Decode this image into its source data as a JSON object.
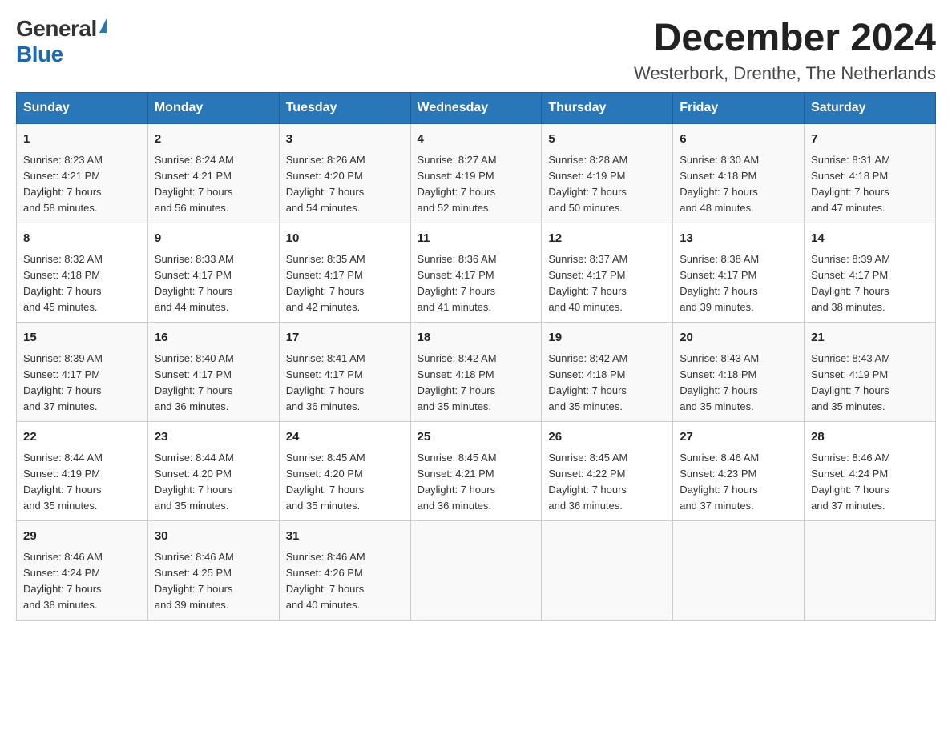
{
  "logo": {
    "general": "General",
    "blue": "Blue"
  },
  "title": "December 2024",
  "location": "Westerbork, Drenthe, The Netherlands",
  "days_of_week": [
    "Sunday",
    "Monday",
    "Tuesday",
    "Wednesday",
    "Thursday",
    "Friday",
    "Saturday"
  ],
  "weeks": [
    [
      {
        "day": "1",
        "sunrise": "8:23 AM",
        "sunset": "4:21 PM",
        "daylight": "7 hours and 58 minutes."
      },
      {
        "day": "2",
        "sunrise": "8:24 AM",
        "sunset": "4:21 PM",
        "daylight": "7 hours and 56 minutes."
      },
      {
        "day": "3",
        "sunrise": "8:26 AM",
        "sunset": "4:20 PM",
        "daylight": "7 hours and 54 minutes."
      },
      {
        "day": "4",
        "sunrise": "8:27 AM",
        "sunset": "4:19 PM",
        "daylight": "7 hours and 52 minutes."
      },
      {
        "day": "5",
        "sunrise": "8:28 AM",
        "sunset": "4:19 PM",
        "daylight": "7 hours and 50 minutes."
      },
      {
        "day": "6",
        "sunrise": "8:30 AM",
        "sunset": "4:18 PM",
        "daylight": "7 hours and 48 minutes."
      },
      {
        "day": "7",
        "sunrise": "8:31 AM",
        "sunset": "4:18 PM",
        "daylight": "7 hours and 47 minutes."
      }
    ],
    [
      {
        "day": "8",
        "sunrise": "8:32 AM",
        "sunset": "4:18 PM",
        "daylight": "7 hours and 45 minutes."
      },
      {
        "day": "9",
        "sunrise": "8:33 AM",
        "sunset": "4:17 PM",
        "daylight": "7 hours and 44 minutes."
      },
      {
        "day": "10",
        "sunrise": "8:35 AM",
        "sunset": "4:17 PM",
        "daylight": "7 hours and 42 minutes."
      },
      {
        "day": "11",
        "sunrise": "8:36 AM",
        "sunset": "4:17 PM",
        "daylight": "7 hours and 41 minutes."
      },
      {
        "day": "12",
        "sunrise": "8:37 AM",
        "sunset": "4:17 PM",
        "daylight": "7 hours and 40 minutes."
      },
      {
        "day": "13",
        "sunrise": "8:38 AM",
        "sunset": "4:17 PM",
        "daylight": "7 hours and 39 minutes."
      },
      {
        "day": "14",
        "sunrise": "8:39 AM",
        "sunset": "4:17 PM",
        "daylight": "7 hours and 38 minutes."
      }
    ],
    [
      {
        "day": "15",
        "sunrise": "8:39 AM",
        "sunset": "4:17 PM",
        "daylight": "7 hours and 37 minutes."
      },
      {
        "day": "16",
        "sunrise": "8:40 AM",
        "sunset": "4:17 PM",
        "daylight": "7 hours and 36 minutes."
      },
      {
        "day": "17",
        "sunrise": "8:41 AM",
        "sunset": "4:17 PM",
        "daylight": "7 hours and 36 minutes."
      },
      {
        "day": "18",
        "sunrise": "8:42 AM",
        "sunset": "4:18 PM",
        "daylight": "7 hours and 35 minutes."
      },
      {
        "day": "19",
        "sunrise": "8:42 AM",
        "sunset": "4:18 PM",
        "daylight": "7 hours and 35 minutes."
      },
      {
        "day": "20",
        "sunrise": "8:43 AM",
        "sunset": "4:18 PM",
        "daylight": "7 hours and 35 minutes."
      },
      {
        "day": "21",
        "sunrise": "8:43 AM",
        "sunset": "4:19 PM",
        "daylight": "7 hours and 35 minutes."
      }
    ],
    [
      {
        "day": "22",
        "sunrise": "8:44 AM",
        "sunset": "4:19 PM",
        "daylight": "7 hours and 35 minutes."
      },
      {
        "day": "23",
        "sunrise": "8:44 AM",
        "sunset": "4:20 PM",
        "daylight": "7 hours and 35 minutes."
      },
      {
        "day": "24",
        "sunrise": "8:45 AM",
        "sunset": "4:20 PM",
        "daylight": "7 hours and 35 minutes."
      },
      {
        "day": "25",
        "sunrise": "8:45 AM",
        "sunset": "4:21 PM",
        "daylight": "7 hours and 36 minutes."
      },
      {
        "day": "26",
        "sunrise": "8:45 AM",
        "sunset": "4:22 PM",
        "daylight": "7 hours and 36 minutes."
      },
      {
        "day": "27",
        "sunrise": "8:46 AM",
        "sunset": "4:23 PM",
        "daylight": "7 hours and 37 minutes."
      },
      {
        "day": "28",
        "sunrise": "8:46 AM",
        "sunset": "4:24 PM",
        "daylight": "7 hours and 37 minutes."
      }
    ],
    [
      {
        "day": "29",
        "sunrise": "8:46 AM",
        "sunset": "4:24 PM",
        "daylight": "7 hours and 38 minutes."
      },
      {
        "day": "30",
        "sunrise": "8:46 AM",
        "sunset": "4:25 PM",
        "daylight": "7 hours and 39 minutes."
      },
      {
        "day": "31",
        "sunrise": "8:46 AM",
        "sunset": "4:26 PM",
        "daylight": "7 hours and 40 minutes."
      },
      null,
      null,
      null,
      null
    ]
  ],
  "labels": {
    "sunrise": "Sunrise:",
    "sunset": "Sunset:",
    "daylight": "Daylight:"
  }
}
